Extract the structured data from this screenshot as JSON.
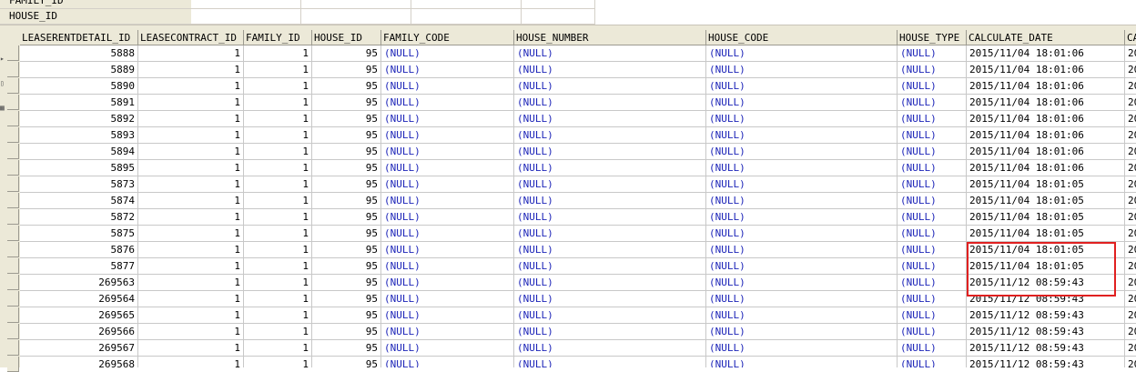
{
  "filter_fields": [
    "FAMILY_ID",
    "HOUSE_ID"
  ],
  "columns": [
    "LEASERENTDETAIL_ID",
    "LEASECONTRACT_ID",
    "FAMILY_ID",
    "HOUSE_ID",
    "FAMILY_CODE",
    "HOUSE_NUMBER",
    "HOUSE_CODE",
    "HOUSE_TYPE",
    "CALCULATE_DATE",
    "CA"
  ],
  "rows": [
    [
      "5888",
      "1",
      "1",
      "95",
      "(NULL)",
      "(NULL)",
      "(NULL)",
      "(NULL)",
      "2015/11/04 18:01:06",
      "20"
    ],
    [
      "5889",
      "1",
      "1",
      "95",
      "(NULL)",
      "(NULL)",
      "(NULL)",
      "(NULL)",
      "2015/11/04 18:01:06",
      "20"
    ],
    [
      "5890",
      "1",
      "1",
      "95",
      "(NULL)",
      "(NULL)",
      "(NULL)",
      "(NULL)",
      "2015/11/04 18:01:06",
      "20"
    ],
    [
      "5891",
      "1",
      "1",
      "95",
      "(NULL)",
      "(NULL)",
      "(NULL)",
      "(NULL)",
      "2015/11/04 18:01:06",
      "20"
    ],
    [
      "5892",
      "1",
      "1",
      "95",
      "(NULL)",
      "(NULL)",
      "(NULL)",
      "(NULL)",
      "2015/11/04 18:01:06",
      "20"
    ],
    [
      "5893",
      "1",
      "1",
      "95",
      "(NULL)",
      "(NULL)",
      "(NULL)",
      "(NULL)",
      "2015/11/04 18:01:06",
      "20"
    ],
    [
      "5894",
      "1",
      "1",
      "95",
      "(NULL)",
      "(NULL)",
      "(NULL)",
      "(NULL)",
      "2015/11/04 18:01:06",
      "20"
    ],
    [
      "5895",
      "1",
      "1",
      "95",
      "(NULL)",
      "(NULL)",
      "(NULL)",
      "(NULL)",
      "2015/11/04 18:01:06",
      "20"
    ],
    [
      "5873",
      "1",
      "1",
      "95",
      "(NULL)",
      "(NULL)",
      "(NULL)",
      "(NULL)",
      "2015/11/04 18:01:05",
      "20"
    ],
    [
      "5874",
      "1",
      "1",
      "95",
      "(NULL)",
      "(NULL)",
      "(NULL)",
      "(NULL)",
      "2015/11/04 18:01:05",
      "20"
    ],
    [
      "5872",
      "1",
      "1",
      "95",
      "(NULL)",
      "(NULL)",
      "(NULL)",
      "(NULL)",
      "2015/11/04 18:01:05",
      "20"
    ],
    [
      "5875",
      "1",
      "1",
      "95",
      "(NULL)",
      "(NULL)",
      "(NULL)",
      "(NULL)",
      "2015/11/04 18:01:05",
      "20"
    ],
    [
      "5876",
      "1",
      "1",
      "95",
      "(NULL)",
      "(NULL)",
      "(NULL)",
      "(NULL)",
      "2015/11/04 18:01:05",
      "20"
    ],
    [
      "5877",
      "1",
      "1",
      "95",
      "(NULL)",
      "(NULL)",
      "(NULL)",
      "(NULL)",
      "2015/11/04 18:01:05",
      "20"
    ],
    [
      "269563",
      "1",
      "1",
      "95",
      "(NULL)",
      "(NULL)",
      "(NULL)",
      "(NULL)",
      "2015/11/12 08:59:43",
      "20"
    ],
    [
      "269564",
      "1",
      "1",
      "95",
      "(NULL)",
      "(NULL)",
      "(NULL)",
      "(NULL)",
      "2015/11/12 08:59:43",
      "20"
    ],
    [
      "269565",
      "1",
      "1",
      "95",
      "(NULL)",
      "(NULL)",
      "(NULL)",
      "(NULL)",
      "2015/11/12 08:59:43",
      "20"
    ],
    [
      "269566",
      "1",
      "1",
      "95",
      "(NULL)",
      "(NULL)",
      "(NULL)",
      "(NULL)",
      "2015/11/12 08:59:43",
      "20"
    ],
    [
      "269567",
      "1",
      "1",
      "95",
      "(NULL)",
      "(NULL)",
      "(NULL)",
      "(NULL)",
      "2015/11/12 08:59:43",
      "20"
    ],
    [
      "269568",
      "1",
      "1",
      "95",
      "(NULL)",
      "(NULL)",
      "(NULL)",
      "(NULL)",
      "2015/11/12 08:59:43",
      "20"
    ]
  ],
  "highlight_color": "#e02020",
  "null_color": "#1c24b8"
}
